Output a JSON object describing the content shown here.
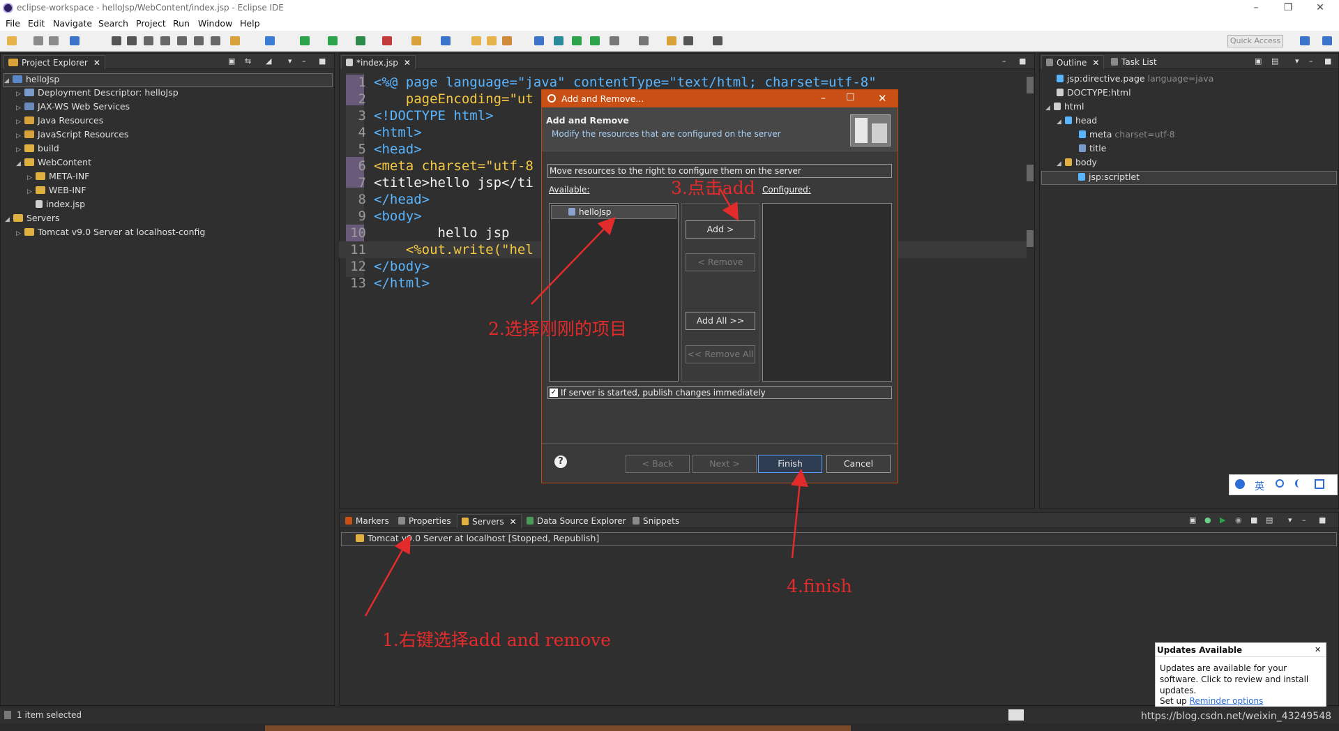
{
  "window": {
    "title": "eclipse-workspace - helloJsp/WebContent/index.jsp - Eclipse IDE"
  },
  "menu": [
    "File",
    "Edit",
    "Navigate",
    "Search",
    "Project",
    "Run",
    "Window",
    "Help"
  ],
  "quick_access": "Quick Access",
  "project_explorer": {
    "tab": "Project Explorer",
    "items": [
      {
        "label": "helloJsp"
      },
      {
        "label": "Deployment Descriptor: helloJsp"
      },
      {
        "label": "JAX-WS Web Services"
      },
      {
        "label": "Java Resources"
      },
      {
        "label": "JavaScript Resources"
      },
      {
        "label": "build"
      },
      {
        "label": "WebContent"
      },
      {
        "label": "META-INF"
      },
      {
        "label": "WEB-INF"
      },
      {
        "label": "index.jsp"
      },
      {
        "label": "Servers"
      },
      {
        "label": "Tomcat v9.0 Server at localhost-config"
      }
    ]
  },
  "editor": {
    "tab": "*index.jsp",
    "line_numbers": [
      "1",
      "2",
      "3",
      "4",
      "5",
      "6",
      "7",
      "8",
      "9",
      "10",
      "11",
      "12",
      "13"
    ],
    "lines": [
      "<%@ page language=\"java\" contentType=\"text/html; charset=utf-8\"",
      "    pageEncoding=\"ut",
      "<!DOCTYPE html>",
      "<html>",
      "<head>",
      "<meta charset=\"utf-8",
      "<title>hello jsp</ti",
      "</head>",
      "<body>",
      "        hello jsp",
      "    <%out.write(\"hel",
      "</body>",
      "</html>"
    ]
  },
  "outline": {
    "tab": "Outline",
    "tab2": "Task List",
    "items": [
      {
        "label": "jsp:directive.page",
        "note": "language=java"
      },
      {
        "label": "DOCTYPE:html",
        "note": ""
      },
      {
        "label": "html",
        "note": ""
      },
      {
        "label": "head",
        "note": ""
      },
      {
        "label": "meta",
        "note": "charset=utf-8"
      },
      {
        "label": "title",
        "note": ""
      },
      {
        "label": "body",
        "note": ""
      },
      {
        "label": "jsp:scriptlet",
        "note": ""
      }
    ]
  },
  "bottom": {
    "tabs": [
      "Markers",
      "Properties",
      "Servers",
      "Data Source Explorer",
      "Snippets"
    ],
    "server_row": "Tomcat v9.0 Server at localhost  [Stopped, Republish]"
  },
  "dialog": {
    "title": "Add and Remove...",
    "header_title": "Add and Remove",
    "header_desc": "Modify the resources that are configured on the server",
    "instruction": "Move resources to the right to configure them on the server",
    "available_label": "Available:",
    "configured_label": "Configured:",
    "available_items": [
      "helloJsp"
    ],
    "btn_add": "Add >",
    "btn_remove": "< Remove",
    "btn_add_all": "Add All >>",
    "btn_remove_all": "<< Remove All",
    "publish_checkbox": "If server is started, publish changes immediately",
    "publish_checked": true,
    "btn_back": "< Back",
    "btn_next": "Next >",
    "btn_finish": "Finish",
    "btn_cancel": "Cancel"
  },
  "annotations": {
    "step1": "1.右键选择add and remove",
    "step2": "2.选择刚刚的项目",
    "step3": "3.点击add",
    "step4": "4.finish",
    "color": "#e32b2b"
  },
  "updates_popup": {
    "title": "Updates Available",
    "body": "Updates are available for your software. Click to review and install updates.",
    "setup_prefix": "Set up ",
    "setup_link": "Reminder options"
  },
  "status": {
    "text": "1 item selected",
    "watermark": "https://blog.csdn.net/weixin_43249548"
  },
  "ime": [
    "英"
  ]
}
